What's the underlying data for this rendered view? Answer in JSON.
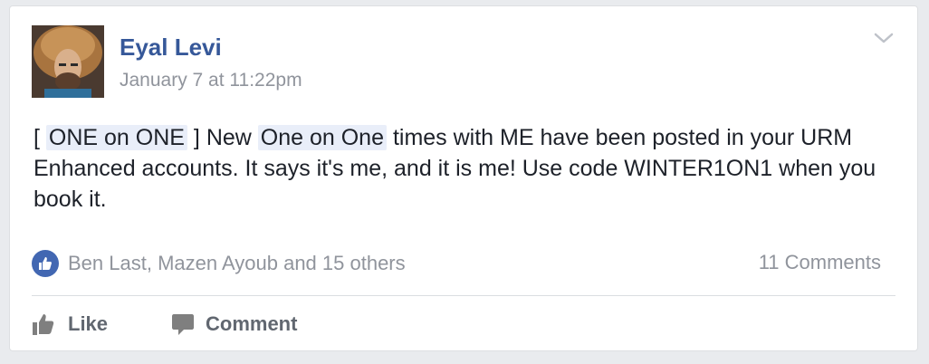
{
  "post": {
    "author": "Eyal Levi",
    "timestamp": "January 7 at 11:22pm",
    "menu_icon": "chevron-down-icon",
    "body": {
      "open_bracket": "[",
      "tag1": "ONE on ONE",
      "after_tag1": "] New",
      "tag2": "One on One",
      "rest": "times with ME have been posted in your URM Enhanced accounts. It says it's me, and it is me! Use code WINTER1ON1 when you book it."
    }
  },
  "reactions": {
    "icon": "like-icon",
    "summary": "Ben Last, Mazen Ayoub and 15 others",
    "comments": "11 Comments"
  },
  "actions": {
    "like": "Like",
    "comment": "Comment"
  },
  "colors": {
    "link": "#365899",
    "meta": "#90949c",
    "like_badge": "#4267b2",
    "tag_highlight": "#e9eef9"
  }
}
